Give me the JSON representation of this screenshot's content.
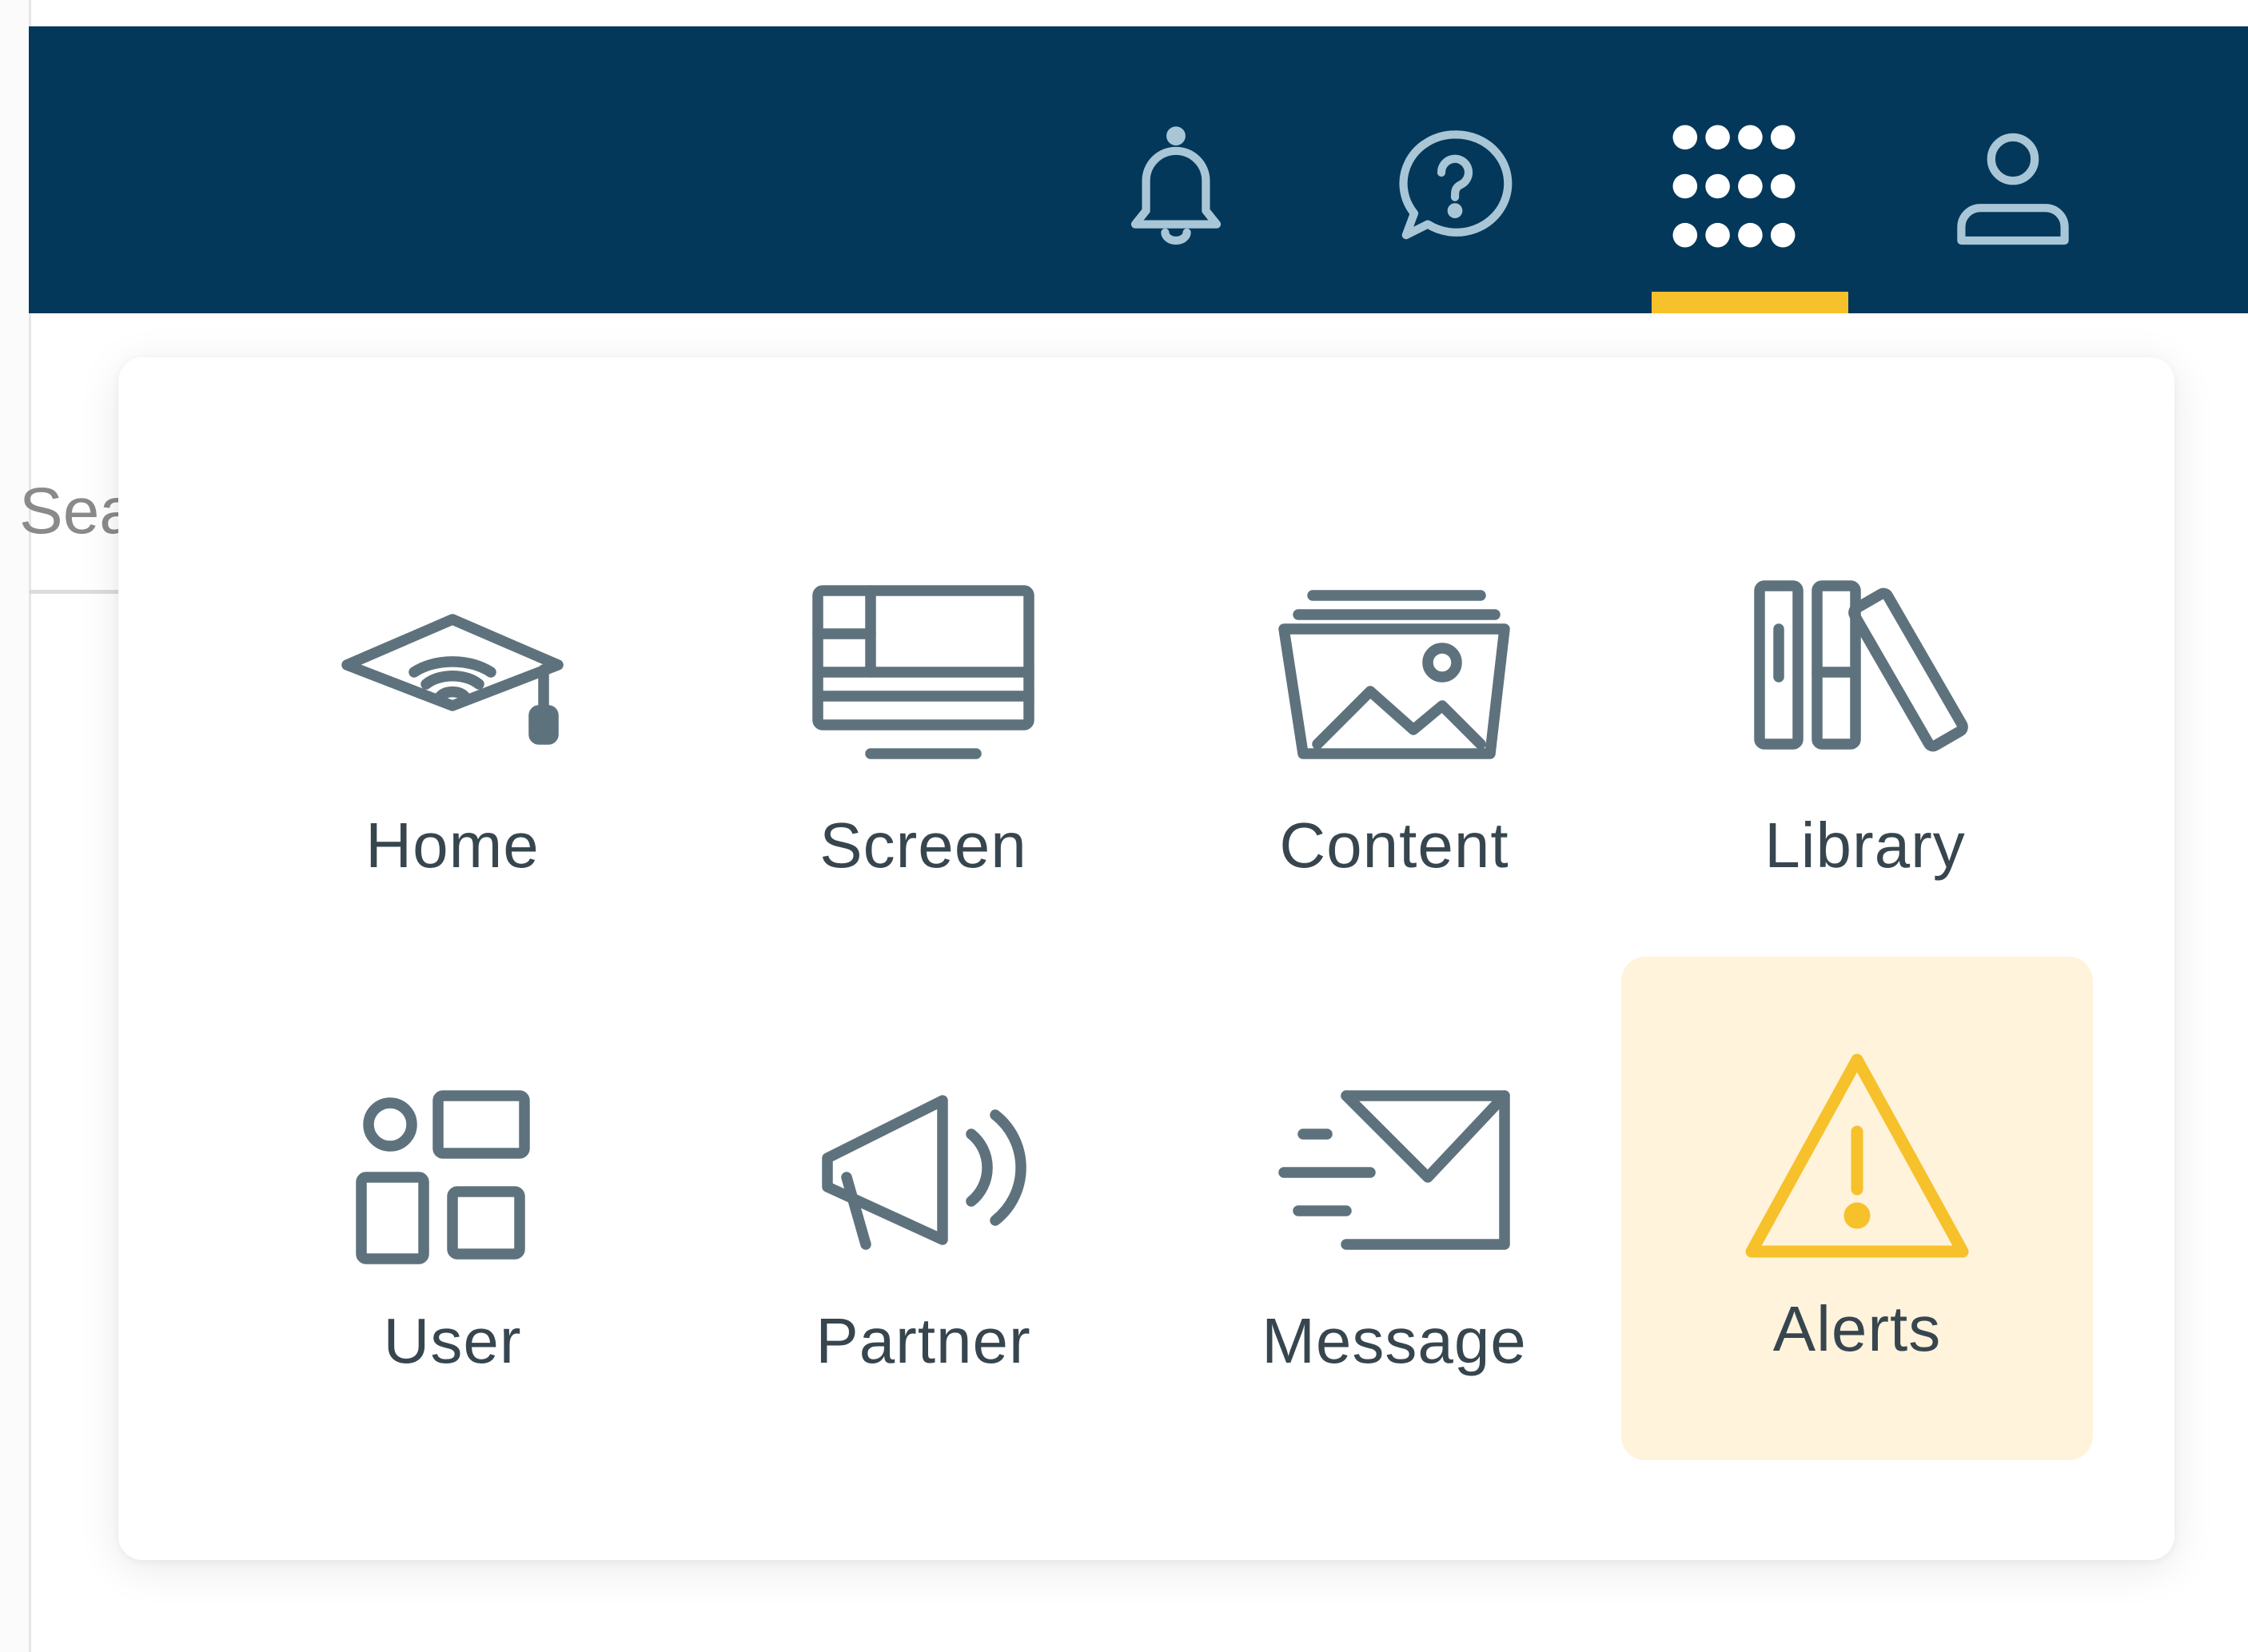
{
  "search": {
    "visible_text": "Sea"
  },
  "header": {
    "icons": [
      {
        "name": "bell-icon",
        "active": false
      },
      {
        "name": "help-chat-icon",
        "active": false
      },
      {
        "name": "app-grid-icon",
        "active": true
      },
      {
        "name": "user-profile-icon",
        "active": false
      }
    ]
  },
  "app_menu": {
    "tiles": [
      {
        "label": "Home",
        "icon": "graduation-cap-icon",
        "highlighted": false
      },
      {
        "label": "Screen",
        "icon": "monitor-icon",
        "highlighted": false
      },
      {
        "label": "Content",
        "icon": "photo-album-icon",
        "highlighted": false
      },
      {
        "label": "Library",
        "icon": "books-icon",
        "highlighted": false
      },
      {
        "label": "User",
        "icon": "user-widgets-icon",
        "highlighted": false
      },
      {
        "label": "Partner",
        "icon": "megaphone-icon",
        "highlighted": false
      },
      {
        "label": "Message",
        "icon": "send-mail-icon",
        "highlighted": false
      },
      {
        "label": "Alerts",
        "icon": "warning-icon",
        "highlighted": true
      }
    ]
  },
  "colors": {
    "header_bg": "#03385a",
    "header_icon": "#a9c6d7",
    "active_indicator": "#f6c12a",
    "tile_icon": "#5e727d",
    "label_text": "#37464e",
    "highlight_bg": "#fff3dc",
    "warning": "#f6c12a"
  }
}
